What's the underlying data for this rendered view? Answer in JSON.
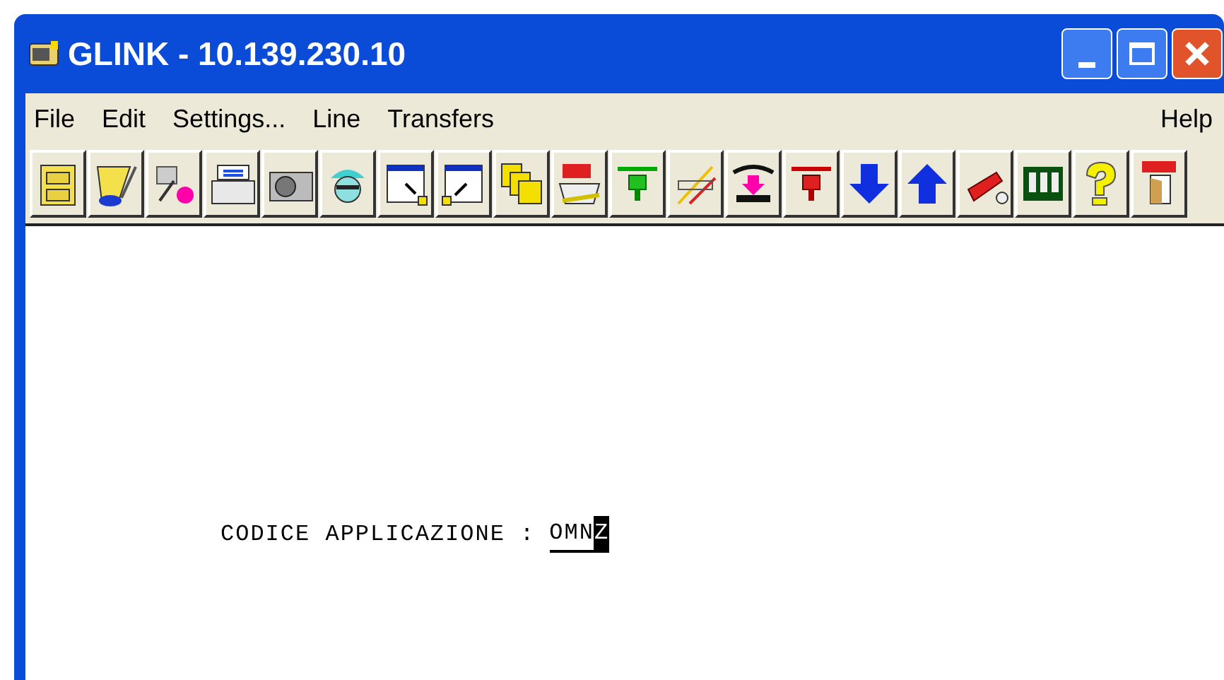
{
  "window": {
    "title": "GLINK - 10.139.230.10"
  },
  "menu": {
    "items": [
      "File",
      "Edit",
      "Settings...",
      "Line",
      "Transfers"
    ],
    "help": "Help"
  },
  "terminal": {
    "prompt": "CODICE APPLICAZIONE :",
    "field_value": "OMN",
    "cursor_char": "Z"
  }
}
